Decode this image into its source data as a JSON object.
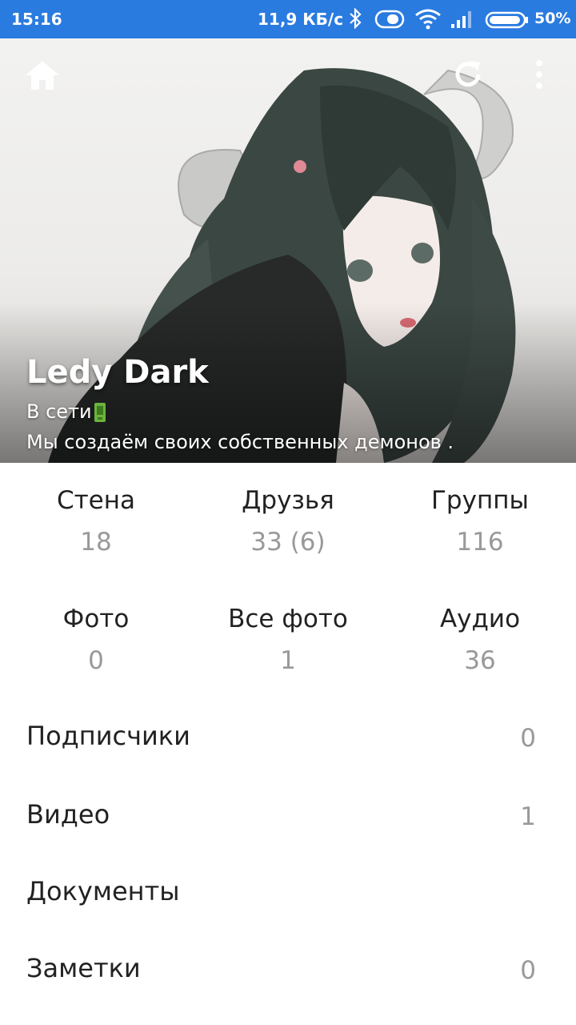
{
  "status_bar": {
    "time": "15:16",
    "net_speed": "11,9 КБ/с",
    "battery": "50%",
    "icons": [
      "bluetooth-icon",
      "data-saver-icon",
      "wifi-icon",
      "signal-icon",
      "battery-icon"
    ],
    "color": "#2a7be0"
  },
  "header": {
    "icons": [
      "home-icon",
      "refresh-icon",
      "more-vert-icon"
    ],
    "name": "Ledy Dark",
    "online": "В сети",
    "online_icon": "mobile-icon",
    "status": "Мы создаём своих собственных демонов ."
  },
  "stats": [
    {
      "label": "Стена",
      "value": "18"
    },
    {
      "label": "Друзья",
      "value": "33 (6)"
    },
    {
      "label": "Группы",
      "value": "116"
    },
    {
      "label": "Фото",
      "value": "0"
    },
    {
      "label": "Все фото",
      "value": "1"
    },
    {
      "label": "Аудио",
      "value": "36"
    }
  ],
  "rows": [
    {
      "label": "Подписчики",
      "value": "0"
    },
    {
      "label": "Видео",
      "value": "1"
    },
    {
      "label": "Документы",
      "value": ""
    },
    {
      "label": "Заметки",
      "value": "0"
    }
  ]
}
